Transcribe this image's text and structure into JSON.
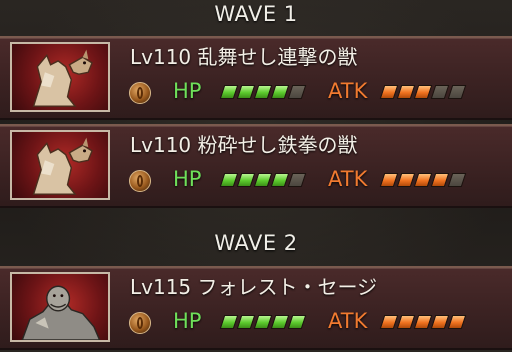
{
  "waves": [
    {
      "title": "WAVE 1",
      "enemies": [
        {
          "name": "Lv110 乱舞せし連撃の獣",
          "portrait_icon": "werewolf-portrait-icon",
          "hp_label": "HP",
          "atk_label": "ATK",
          "hp_level": 4,
          "atk_level": 3,
          "max_level": 5
        },
        {
          "name": "Lv110 粉砕せし鉄拳の獣",
          "portrait_icon": "werewolf-portrait-icon",
          "hp_label": "HP",
          "atk_label": "ATK",
          "hp_level": 4,
          "atk_level": 4,
          "max_level": 5
        }
      ]
    },
    {
      "title": "WAVE 2",
      "enemies": [
        {
          "name": "Lv115 フォレスト・セージ",
          "portrait_icon": "ogre-portrait-icon",
          "hp_label": "HP",
          "atk_label": "ATK",
          "hp_level": 5,
          "atk_level": 5,
          "max_level": 5
        }
      ]
    }
  ],
  "colors": {
    "hp": "#6fe05a",
    "atk": "#f07a30",
    "card_bg": "#3b2222",
    "portrait_bg": "#8a1a1a"
  },
  "element_icon": "earth-element-icon"
}
